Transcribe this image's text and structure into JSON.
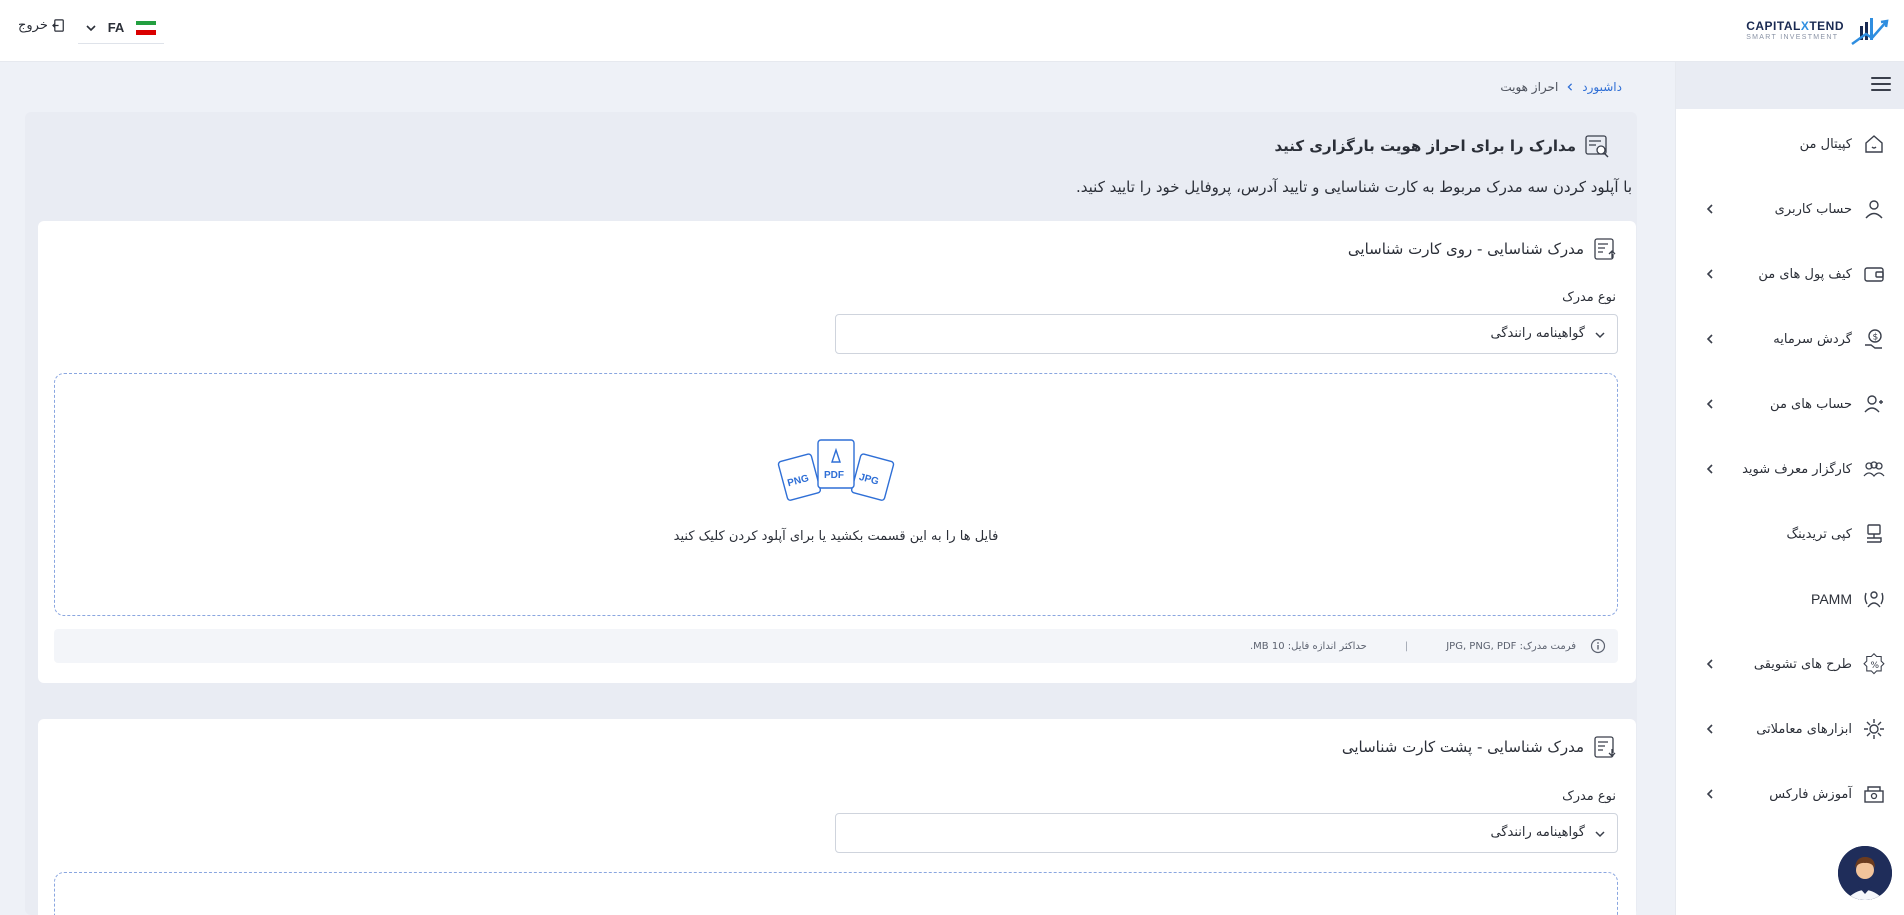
{
  "header": {
    "logo_name_1": "CAPITAL",
    "logo_name_x": "X",
    "logo_name_2": "TEND",
    "logo_sub": "SMART INVESTMENT",
    "lang_code": "FA",
    "logout_label": "خروج"
  },
  "sidebar": {
    "items": [
      {
        "label": "کپیتال من",
        "icon": "home-icon",
        "chevron": false
      },
      {
        "label": "حساب کاربری",
        "icon": "user-icon",
        "chevron": true
      },
      {
        "label": "کیف پول های من",
        "icon": "wallet-icon",
        "chevron": true
      },
      {
        "label": "گردش سرمایه",
        "icon": "money-flow-icon",
        "chevron": true
      },
      {
        "label": "حساب های من",
        "icon": "accounts-icon",
        "chevron": true
      },
      {
        "label": "کارگزار معرف شوید",
        "icon": "partners-icon",
        "chevron": true
      },
      {
        "label": "کپی تریدینگ",
        "icon": "copy-trading-icon",
        "chevron": false
      },
      {
        "label": "PAMM",
        "icon": "pamm-icon",
        "chevron": false
      },
      {
        "label": "طرح های تشویقی",
        "icon": "bonus-icon",
        "chevron": true
      },
      {
        "label": "ابزارهای معاملاتی",
        "icon": "tools-icon",
        "chevron": true
      },
      {
        "label": "آموزش فارکس",
        "icon": "education-icon",
        "chevron": true
      }
    ]
  },
  "breadcrumb": {
    "home": "داشبورد",
    "current": "احراز هویت"
  },
  "page": {
    "title": "مدارک را برای احراز هویت بارگزاری کنید",
    "description": "با آپلود کردن سه مدرک مربوط به کارت شناسایی و تایید آدرس، پروفایل خود را تایید کنید."
  },
  "cards": [
    {
      "title": "مدرک شناسایی - روی کارت شناسایی",
      "field_label": "نوع مدرک",
      "select_value": "گواهینامه رانندگی",
      "dropzone_text": "فایل ها را به این قسمت بکشید یا برای آپلود کردن کلیک کنید",
      "format_label": "فرمت مدرک: JPG, PNG, PDF",
      "max_size_label": "حداکثر اندازه فایل: 10 MB."
    },
    {
      "title": "مدرک شناسایی - پشت کارت شناسایی",
      "field_label": "نوع مدرک",
      "select_value": "گواهینامه رانندگی"
    }
  ],
  "dropzone_badges": {
    "png": "PNG",
    "pdf": "PDF",
    "jpg": "JPG"
  },
  "colors": {
    "accent": "#2f6fd6",
    "dashed_border": "#8aa6e0",
    "background": "#eef1f7"
  }
}
